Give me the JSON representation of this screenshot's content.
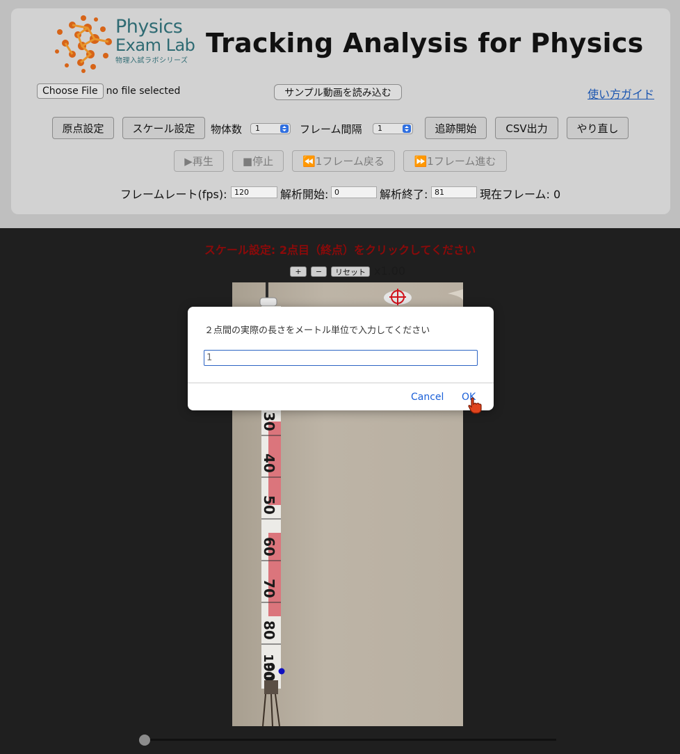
{
  "logo": {
    "line1": "Physics",
    "line2": "Exam Lab",
    "tagline": "物理入試ラボシリーズ"
  },
  "app_title": "Tracking Analysis for Physics",
  "file": {
    "choose_label": "Choose File",
    "status": "no file selected"
  },
  "sample_button": "サンプル動画を読み込む",
  "guide_link": "使い方ガイド",
  "toolbar": {
    "origin_button": "原点設定",
    "scale_button": "スケール設定",
    "objects_label": "物体数",
    "objects_value": "1",
    "interval_label": "フレーム間隔",
    "interval_value": "1",
    "track_button": "追跡開始",
    "csv_button": "CSV出力",
    "redo_button": "やり直し"
  },
  "playback": {
    "play": "▶再生",
    "stop": "■停止",
    "back": "⏪1フレーム戻る",
    "forward": "⏩1フレーム進む"
  },
  "fields": {
    "fps_label": "フレームレート(fps):",
    "fps_value": "120",
    "start_label": "解析開始:",
    "start_value": "0",
    "end_label": "解析終了:",
    "end_value": "81",
    "current_label": "現在フレーム: 0"
  },
  "stage": {
    "instruction": "スケール設定: 2点目（終点）をクリックしてください",
    "zoom_in": "+",
    "zoom_out": "−",
    "zoom_reset": "リセット",
    "zoom_level": "x1.00",
    "ruler_marks": [
      "30",
      "40",
      "50",
      "60",
      "70",
      "80",
      "90",
      "100"
    ],
    "slider_position": 0
  },
  "dialog": {
    "message": "２点間の実際の長さをメートル単位で入力してください",
    "input_value": "1",
    "cancel": "Cancel",
    "ok": "OK"
  },
  "colors": {
    "instruction": "#8b0a0a",
    "link": "#1a55b0",
    "marker": "#d0121b",
    "point": "#1010c0",
    "logo_text": "#2f6b73",
    "logo_mark": "#d76418"
  }
}
